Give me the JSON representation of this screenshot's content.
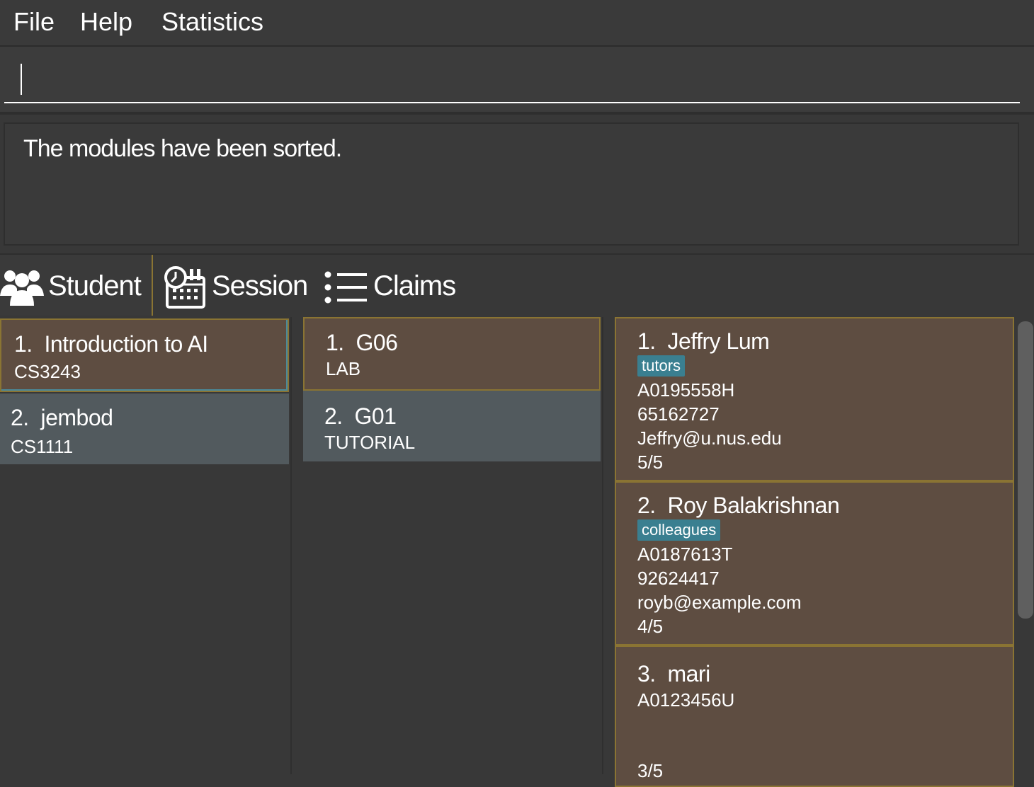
{
  "menu": {
    "file": "File",
    "help": "Help",
    "statistics": "Statistics"
  },
  "command": {
    "value": "",
    "placeholder": ""
  },
  "result": {
    "message": "The modules have been sorted."
  },
  "tabs": [
    {
      "label": "Student",
      "icon": "students-icon",
      "selected": true
    },
    {
      "label": "Session",
      "icon": "calendar-clock-icon",
      "selected": false
    },
    {
      "label": "Claims",
      "icon": "list-icon",
      "selected": false
    }
  ],
  "modules": [
    {
      "index": "1.",
      "name": "Introduction to AI",
      "code": "CS3243"
    },
    {
      "index": "2.",
      "name": "jembod",
      "code": "CS1111"
    }
  ],
  "sessions": [
    {
      "index": "1.",
      "name": "G06",
      "type": "LAB"
    },
    {
      "index": "2.",
      "name": "G01",
      "type": "TUTORIAL"
    }
  ],
  "students": [
    {
      "index": "1.",
      "name": "Jeffry Lum",
      "tag": "tutors",
      "matric": "A0195558H",
      "phone": "65162727",
      "email": "Jeffry@u.nus.edu",
      "attendance": "5/5"
    },
    {
      "index": "2.",
      "name": "Roy Balakrishnan",
      "tag": "colleagues",
      "matric": "A0187613T",
      "phone": "92624417",
      "email": "royb@example.com",
      "attendance": "4/5"
    },
    {
      "index": "3.",
      "name": "mari",
      "matric": "A0123456U",
      "attendance": "3/5"
    }
  ],
  "colors": {
    "background": "#383838",
    "card_selected": "#5e4d41",
    "card_border": "#8a7433",
    "card_plain": "#525a5e",
    "tag": "#3a7f90"
  }
}
